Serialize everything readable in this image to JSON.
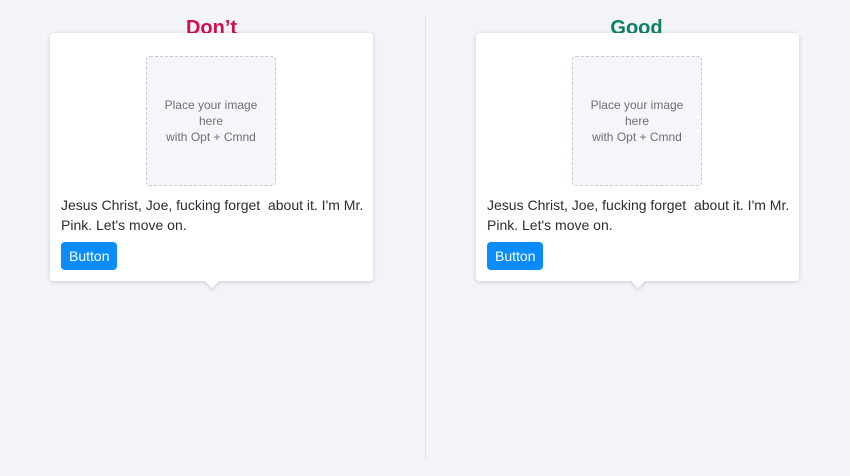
{
  "colors": {
    "background": "#f3f4f8",
    "dont_heading": "#d0104c",
    "good_heading": "#0e7f63",
    "button": "#0a8dfa",
    "card": "#ffffff"
  },
  "panels": [
    {
      "heading": "Don’t",
      "card": {
        "placeholder_line1": "Place your image",
        "placeholder_line2": "here",
        "placeholder_line3": "with Opt + Cmnd",
        "body_text": "Jesus Christ, Joe, fucking forget  about it. I'm Mr. Pink. Let's move on.",
        "button_label": "Button"
      }
    },
    {
      "heading": "Good",
      "card": {
        "placeholder_line1": "Place your image",
        "placeholder_line2": "here",
        "placeholder_line3": "with Opt + Cmnd",
        "body_text": "Jesus Christ, Joe, fucking forget  about it. I'm Mr. Pink. Let's move on.",
        "button_label": "Button"
      }
    }
  ]
}
